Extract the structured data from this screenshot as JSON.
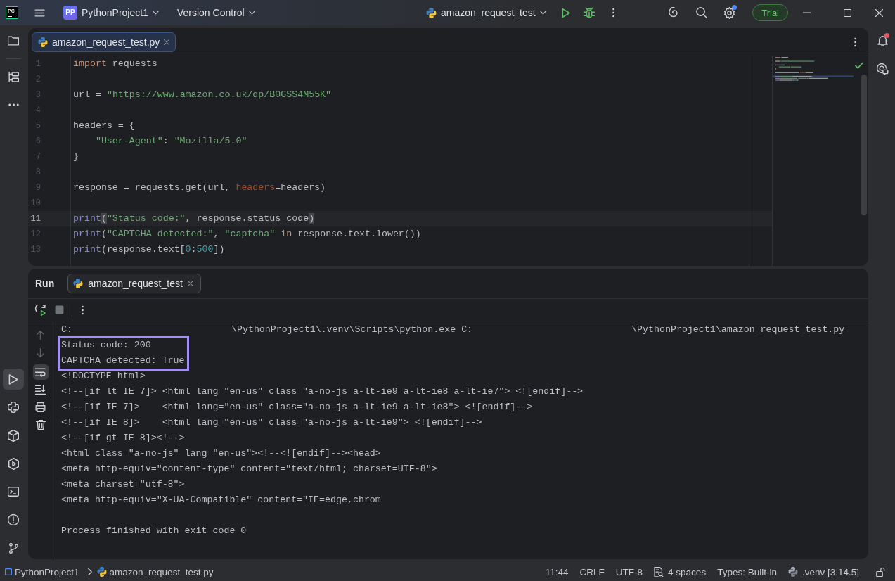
{
  "title_bar": {
    "logo": "PC",
    "project_avatar": "PP",
    "project": "PythonProject1",
    "vcs": "Version Control",
    "run_configuration": "amazon_request_test",
    "settings_badge": true,
    "trial": "Trial"
  },
  "left_toolbar": {
    "top": [
      {
        "kind": "project",
        "selected": false
      },
      {
        "kind": "structure",
        "selected": false
      },
      {
        "kind": "more",
        "selected": false
      }
    ],
    "bottom": [
      {
        "kind": "run",
        "selected": true
      },
      {
        "kind": "python_console",
        "selected": false
      },
      {
        "kind": "packages",
        "selected": false
      },
      {
        "kind": "services",
        "selected": false
      },
      {
        "kind": "terminal",
        "selected": false
      },
      {
        "kind": "problems",
        "selected": false
      },
      {
        "kind": "git",
        "selected": false
      }
    ]
  },
  "right_toolbar": [
    {
      "kind": "notifications",
      "badge": true
    },
    {
      "kind": "ai_chat",
      "badge": false
    }
  ],
  "editor": {
    "tabs": [
      {
        "label": "amazon_request_test.py",
        "selected": true
      }
    ],
    "analysis_passed": true,
    "lines": [
      {
        "number": "1",
        "current": false,
        "tokens": [
          {
            "kind": "keyword",
            "text": "import"
          },
          {
            "kind": "plain",
            "text": " requests"
          }
        ]
      },
      {
        "number": "2",
        "current": false
      },
      {
        "number": "3",
        "current": false,
        "tokens": [
          {
            "kind": "plain",
            "text": "url = "
          },
          {
            "kind": "string",
            "text": "\""
          },
          {
            "kind": "link",
            "text": "https://www.amazon.co.uk/dp/B0GSS4M55K"
          },
          {
            "kind": "string",
            "text": "\""
          }
        ]
      },
      {
        "number": "4",
        "current": false
      },
      {
        "number": "5",
        "current": false,
        "tokens": [
          {
            "kind": "plain",
            "text": "headers = {"
          }
        ],
        "children": [
          {
            "number": "6",
            "current": false,
            "tokens": [
              {
                "kind": "string",
                "text": "\"User-Agent\""
              },
              {
                "kind": "plain",
                "text": ": "
              },
              {
                "kind": "string",
                "text": "\"Mozilla/5.0\""
              }
            ]
          }
        ]
      },
      {
        "number": "7",
        "current": false,
        "tokens": [
          {
            "kind": "plain",
            "text": "}"
          }
        ]
      },
      {
        "number": "8",
        "current": false
      },
      {
        "number": "9",
        "current": false,
        "tokens": [
          {
            "kind": "plain",
            "text": "response = requests.get(url, "
          },
          {
            "kind": "param",
            "text": "headers"
          },
          {
            "kind": "plain",
            "text": "=headers)"
          }
        ]
      },
      {
        "number": "10",
        "current": false
      },
      {
        "number": "11",
        "current": true,
        "tokens": [
          {
            "kind": "builtin",
            "text": "print"
          },
          {
            "kind": "paren_match",
            "text": "("
          },
          {
            "kind": "string",
            "text": "\"Status code:\""
          },
          {
            "kind": "plain",
            "text": ", response.status_code"
          },
          {
            "kind": "paren_match",
            "text": ")"
          }
        ]
      },
      {
        "number": "12",
        "current": false,
        "tokens": [
          {
            "kind": "builtin",
            "text": "print"
          },
          {
            "kind": "plain",
            "text": "("
          },
          {
            "kind": "string",
            "text": "\"CAPTCHA detected:\""
          },
          {
            "kind": "plain",
            "text": ", "
          },
          {
            "kind": "string",
            "text": "\"captcha\""
          },
          {
            "kind": "keyword",
            "text": " in"
          },
          {
            "kind": "plain",
            "text": " response.text.lower())"
          }
        ]
      },
      {
        "number": "13",
        "current": false,
        "tokens": [
          {
            "kind": "builtin",
            "text": "print"
          },
          {
            "kind": "plain",
            "text": "(response.text["
          },
          {
            "kind": "number",
            "text": "0"
          },
          {
            "kind": "plain",
            "text": ":"
          },
          {
            "kind": "number",
            "text": "500"
          },
          {
            "kind": "plain",
            "text": "])"
          }
        ]
      }
    ]
  },
  "run": {
    "title": "Run",
    "tabs": [
      {
        "label": "amazon_request_test",
        "selected": true
      }
    ],
    "soft_wrap": true,
    "console": [
      {
        "kind": "command",
        "highlighted": false,
        "segments": [
          "C:",
          "\\PythonProject1\\.venv\\Scripts\\python.exe C:",
          "\\PythonProject1\\amazon_request_test.py"
        ]
      },
      {
        "kind": "output",
        "highlighted": true,
        "text": "Status code: 200"
      },
      {
        "kind": "output",
        "highlighted": true,
        "text": "CAPTCHA detected: True"
      },
      {
        "kind": "output",
        "highlighted": false,
        "text": "<!DOCTYPE html>"
      },
      {
        "kind": "output",
        "highlighted": false,
        "text": "<!--[if lt IE 7]> <html lang=\"en-us\" class=\"a-no-js a-lt-ie9 a-lt-ie8 a-lt-ie7\"> <![endif]-->"
      },
      {
        "kind": "output",
        "highlighted": false,
        "text": "<!--[if IE 7]>    <html lang=\"en-us\" class=\"a-no-js a-lt-ie9 a-lt-ie8\"> <![endif]-->"
      },
      {
        "kind": "output",
        "highlighted": false,
        "text": "<!--[if IE 8]>    <html lang=\"en-us\" class=\"a-no-js a-lt-ie9\"> <![endif]-->"
      },
      {
        "kind": "output",
        "highlighted": false,
        "text": "<!--[if gt IE 8]><!-->"
      },
      {
        "kind": "output",
        "highlighted": false,
        "text": "<html class=\"a-no-js\" lang=\"en-us\"><!--<![endif]--><head>"
      },
      {
        "kind": "output",
        "highlighted": false,
        "text": "<meta http-equiv=\"content-type\" content=\"text/html; charset=UTF-8\">"
      },
      {
        "kind": "output",
        "highlighted": false,
        "text": "<meta charset=\"utf-8\">"
      },
      {
        "kind": "output",
        "highlighted": false,
        "text": "<meta http-equiv=\"X-UA-Compatible\" content=\"IE=edge,chrom"
      },
      {
        "kind": "exit",
        "highlighted": false,
        "text": "Process finished with exit code 0"
      }
    ]
  },
  "status_bar": {
    "breadcrumbs": [
      {
        "kind": "project",
        "label": "PythonProject1"
      },
      {
        "kind": "file",
        "label": "amazon_request_test.py"
      }
    ],
    "caret_position": "11:44",
    "line_separator": "CRLF",
    "encoding": "UTF-8",
    "indent": "4 spaces",
    "types": "Types: Built-in",
    "interpreter": ".venv [3.14.5]"
  }
}
